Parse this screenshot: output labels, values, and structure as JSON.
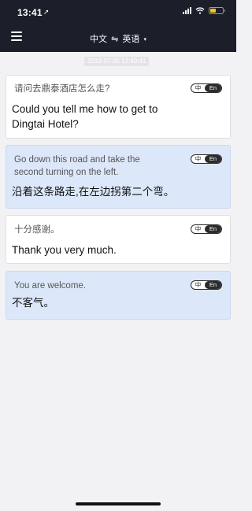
{
  "status_bar": {
    "time": "13:41",
    "location_glyph": "➚"
  },
  "header": {
    "lang_from": "中文",
    "swap_glyph": "⇋",
    "lang_to": "英语",
    "caret": "▾"
  },
  "timestamp": "2019-07-05 13:40:41",
  "messages": [
    {
      "small": "请问去鼎泰酒店怎么走?",
      "big": [
        "Could you tell me how to get to",
        "Dingtai Hotel?"
      ],
      "toggle_zh": "中",
      "toggle_en": "En"
    },
    {
      "small": [
        "Go down this road and take the",
        "second turning on the left."
      ],
      "big": "沿着这条路走,在左边拐第二个弯。",
      "toggle_zh": "中",
      "toggle_en": "En"
    },
    {
      "small": "十分感谢。",
      "big": "Thank you very much.",
      "toggle_zh": "中",
      "toggle_en": "En"
    },
    {
      "small": "You are welcome.",
      "big": "不客气。",
      "toggle_zh": "中",
      "toggle_en": "En"
    }
  ],
  "icons": [
    "menu-icon",
    "signal-icon",
    "wifi-icon",
    "battery-icon",
    "location-arrow-icon"
  ],
  "colors": {
    "header": "#1c1f2a",
    "source_card": "#ffffff",
    "translation_card": "#dce8f9",
    "battery": "#f5c518"
  }
}
